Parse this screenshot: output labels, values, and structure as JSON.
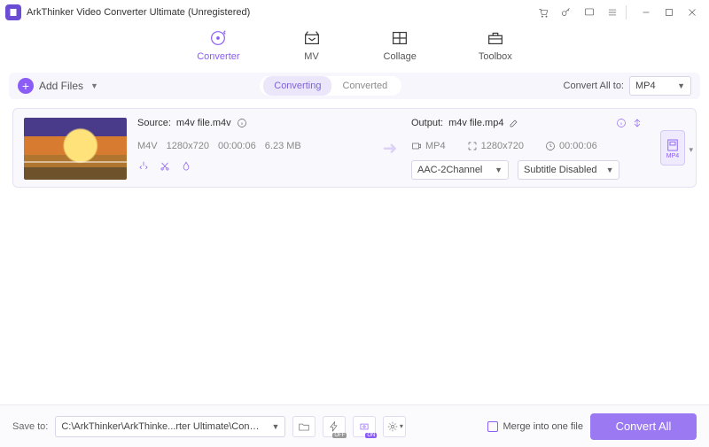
{
  "titlebar": {
    "title": "ArkThinker Video Converter Ultimate (Unregistered)"
  },
  "tabs": {
    "converter": "Converter",
    "mv": "MV",
    "collage": "Collage",
    "toolbox": "Toolbox"
  },
  "toolbar": {
    "add_files": "Add Files",
    "converting": "Converting",
    "converted": "Converted",
    "convert_all_to": "Convert All to:",
    "convert_all_format": "MP4"
  },
  "file": {
    "source_label": "Source:",
    "source_name": "m4v file.m4v",
    "src_format": "M4V",
    "src_res": "1280x720",
    "src_dur": "00:00:06",
    "src_size": "6.23 MB",
    "output_label": "Output:",
    "output_name": "m4v file.mp4",
    "out_format": "MP4",
    "out_res": "1280x720",
    "out_dur": "00:00:06",
    "audio_sel": "AAC-2Channel",
    "subtitle_sel": "Subtitle Disabled",
    "fmt_badge": "MP4"
  },
  "bottom": {
    "save_to": "Save to:",
    "path": "C:\\ArkThinker\\ArkThinke...rter Ultimate\\Converted",
    "merge": "Merge into one file",
    "convert_all": "Convert All",
    "gpu_on": "ON",
    "hs_off": "OFF"
  }
}
